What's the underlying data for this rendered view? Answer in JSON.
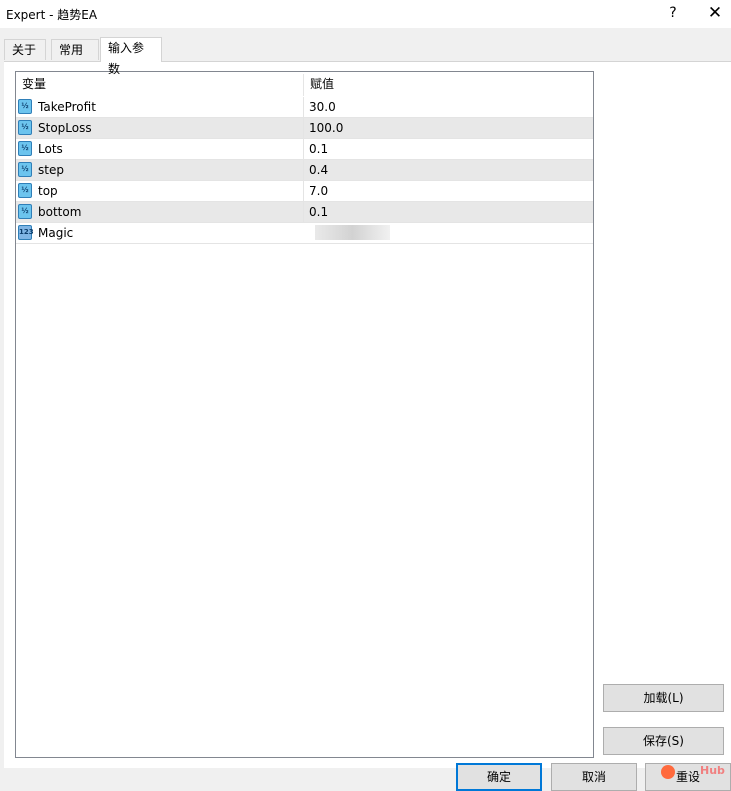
{
  "window": {
    "title": "Expert - 趋势EA",
    "help": "?",
    "close": "✕"
  },
  "tabs": [
    {
      "label": "关于"
    },
    {
      "label": "常用"
    },
    {
      "label": "输入参数",
      "active": true
    }
  ],
  "grid": {
    "columns": [
      "变量",
      "赋值"
    ],
    "rows": [
      {
        "name": "TakeProfit",
        "value": "30.0",
        "icon": "double-value-icon"
      },
      {
        "name": "StopLoss",
        "value": "100.0",
        "icon": "double-value-icon"
      },
      {
        "name": "Lots",
        "value": "0.1",
        "icon": "double-value-icon"
      },
      {
        "name": "step",
        "value": "0.4",
        "icon": "double-value-icon"
      },
      {
        "name": "top",
        "value": "7.0",
        "icon": "double-value-icon"
      },
      {
        "name": "bottom",
        "value": "0.1",
        "icon": "double-value-icon"
      },
      {
        "name": "Magic",
        "value": "",
        "icon": "integer-value-icon",
        "value_obscured": true
      }
    ]
  },
  "buttons": {
    "load": "加载(L)",
    "save": "保存(S)",
    "ok": "确定",
    "cancel": "取消",
    "reset": "重设"
  },
  "watermark": "Hub"
}
